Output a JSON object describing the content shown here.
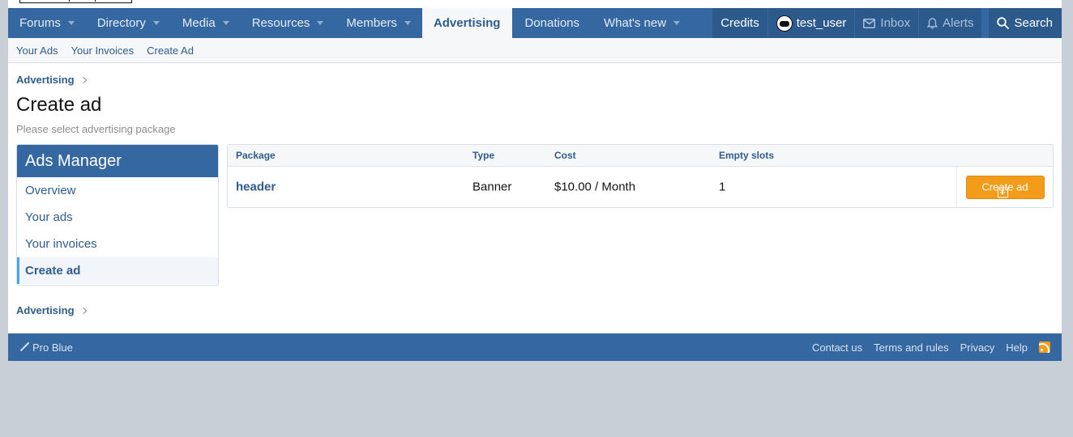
{
  "nav": {
    "items": [
      {
        "label": "Forums",
        "dropdown": true
      },
      {
        "label": "Directory",
        "dropdown": true
      },
      {
        "label": "Media",
        "dropdown": true
      },
      {
        "label": "Resources",
        "dropdown": true
      },
      {
        "label": "Members",
        "dropdown": true
      },
      {
        "label": "Advertising",
        "active": true
      },
      {
        "label": "Donations"
      },
      {
        "label": "What's new",
        "dropdown": true
      }
    ],
    "credits": "Credits",
    "username": "test_user",
    "inbox": "Inbox",
    "alerts": "Alerts",
    "search": "Search"
  },
  "subnav": {
    "links": [
      "Your Ads",
      "Your Invoices",
      "Create Ad"
    ]
  },
  "breadcrumb": {
    "top": "Advertising",
    "bottom": "Advertising"
  },
  "page": {
    "title": "Create ad",
    "description": "Please select advertising package"
  },
  "sidebar": {
    "title": "Ads Manager",
    "items": [
      "Overview",
      "Your ads",
      "Your invoices",
      "Create ad"
    ],
    "selected": "Create ad"
  },
  "table": {
    "headers": [
      "Package",
      "Type",
      "Cost",
      "Empty slots"
    ],
    "rows": [
      {
        "package": "header",
        "type": "Banner",
        "cost": "$10.00 / Month",
        "empty_slots": "1",
        "action": "Create ad"
      }
    ]
  },
  "footer": {
    "style": "Pro Blue",
    "links": [
      "Contact us",
      "Terms and rules",
      "Privacy",
      "Help"
    ]
  },
  "colors": {
    "brand": "#3567a0",
    "accent_button": "#f39c1a",
    "link": "#2f5c8f"
  }
}
